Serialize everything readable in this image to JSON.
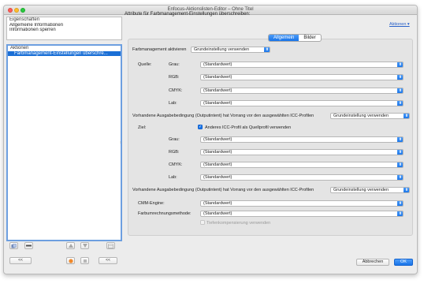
{
  "window": {
    "title": "Enfocus-Aktionslisten-Editor – Ohne Titel"
  },
  "left": {
    "properties": {
      "header": "Eigenschaften",
      "items": [
        "Allgemeine Informationen",
        "Informationen sperren"
      ]
    },
    "actions": {
      "header": "Aktionen",
      "items": [
        "Farbmanagement-Einstellungen überschre..."
      ]
    },
    "buttons": {
      "collapse_left": "<<",
      "collapse_right": "<<"
    }
  },
  "main": {
    "header": "Attribute für Farbmanagement-Einstellungen überschreiben:",
    "sidebar_link": "Aktionen ▾",
    "tabs": [
      {
        "label": "Allgemein",
        "active": true
      },
      {
        "label": "Bilder",
        "active": false
      }
    ],
    "farbmanagement": {
      "label": "Farbmanagement aktivieren",
      "value": "Grundeinstellung verwenden"
    },
    "quelle": {
      "label": "Quelle:",
      "rows": [
        {
          "label": "Grau:",
          "value": "(Standardwert)"
        },
        {
          "label": "RGB:",
          "value": "(Standardwert)"
        },
        {
          "label": "CMYK:",
          "value": "(Standardwert)"
        },
        {
          "label": "Lab:",
          "value": "(Standardwert)"
        }
      ]
    },
    "outputintent_1": {
      "label": "Vorhandene Ausgabebedingung (Outputintent) hat Vorrang vor den ausgewählten ICC-Profilen",
      "value": "Grundeinstellung verwenden"
    },
    "ziel": {
      "label": "Ziel:",
      "checkbox_label": "Anderes ICC-Profil als Quellprofil verwenden",
      "checked": true,
      "rows": [
        {
          "label": "Grau:",
          "value": "(Standardwert)"
        },
        {
          "label": "RGB:",
          "value": "(Standardwert)"
        },
        {
          "label": "CMYK:",
          "value": "(Standardwert)"
        },
        {
          "label": "Lab:",
          "value": "(Standardwert)"
        }
      ]
    },
    "outputintent_2": {
      "label": "Vorhandene Ausgabebedingung (Outputintent) hat Vorrang vor den ausgewählten ICC-Profilen",
      "value": "Grundeinstellung verwenden"
    },
    "cmm": {
      "label": "CMM-Engine:",
      "value": "(Standardwert)"
    },
    "methode": {
      "label": "Farbumrechnungsmethode:",
      "value": "(Standardwert)"
    },
    "tiefen": {
      "label": "Tiefenkompensierung verwenden",
      "checked": false
    }
  },
  "footer": {
    "cancel": "Abbrechen",
    "ok": "OK"
  },
  "colors": {
    "accent": "#1874e8",
    "selection": "#1a6fd6",
    "link": "#2a62c9"
  }
}
